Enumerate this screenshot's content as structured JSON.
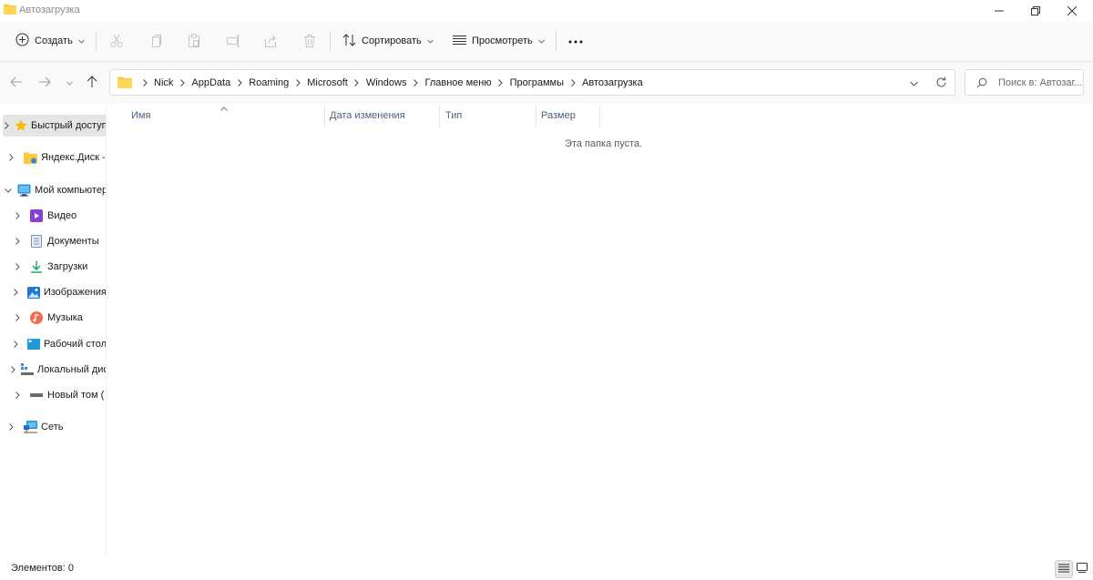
{
  "window": {
    "title": "Автозагрузка"
  },
  "commandbar": {
    "new_label": "Создать",
    "sort_label": "Сортировать",
    "view_label": "Просмотреть",
    "more_label": "···"
  },
  "address": {
    "crumbs": [
      "Nick",
      "AppData",
      "Roaming",
      "Microsoft",
      "Windows",
      "Главное меню",
      "Программы",
      "Автозагрузка"
    ]
  },
  "search": {
    "placeholder": "Поиск в: Автозаг..."
  },
  "navpane": {
    "items": [
      {
        "label": "Быстрый доступ",
        "icon": "star-icon"
      },
      {
        "label": "Яндекс.Диск - ",
        "icon": "yandex-disk-icon"
      },
      {
        "label": "Мой компьютер",
        "icon": "computer-icon"
      },
      {
        "label": "Видео",
        "icon": "video-icon"
      },
      {
        "label": "Документы",
        "icon": "documents-icon"
      },
      {
        "label": "Загрузки",
        "icon": "downloads-icon"
      },
      {
        "label": "Изображения",
        "icon": "pictures-icon"
      },
      {
        "label": "Музыка",
        "icon": "music-icon"
      },
      {
        "label": "Рабочий стол",
        "icon": "desktop-icon"
      },
      {
        "label": "Локальный диск",
        "icon": "local-disk-icon"
      },
      {
        "label": "Новый том (",
        "icon": "drive-icon"
      },
      {
        "label": "Сеть",
        "icon": "network-icon"
      }
    ]
  },
  "columns": {
    "name": "Имя",
    "date": "Дата изменения",
    "type": "Тип",
    "size": "Размер"
  },
  "content": {
    "empty_message": "Эта папка пуста."
  },
  "statusbar": {
    "items_text": "Элементов: 0"
  },
  "colors": {
    "folder_yellow": "#ffc83d",
    "column_header_text": "#4d6082",
    "selected_bg": "#e5e5e5",
    "commandbar_bg": "#f9f9f9"
  }
}
